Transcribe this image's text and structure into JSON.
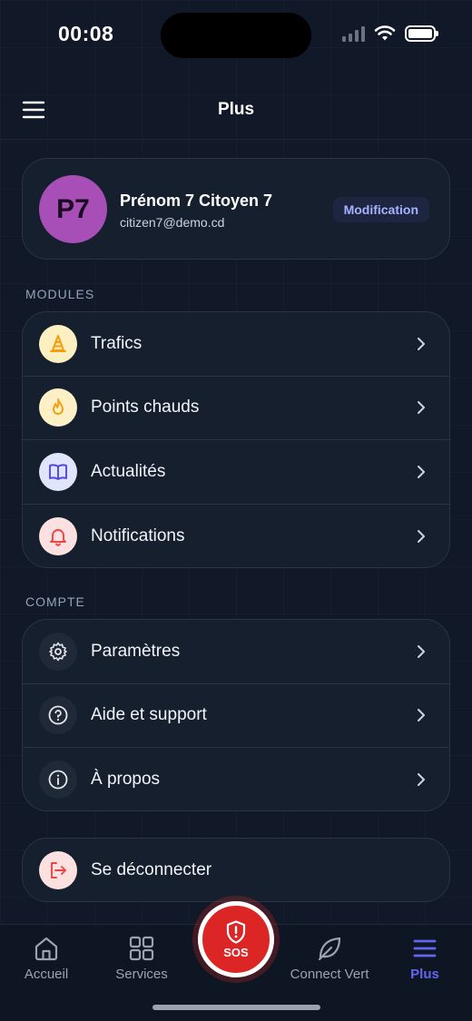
{
  "status_bar": {
    "time": "00:08"
  },
  "header": {
    "title": "Plus"
  },
  "profile": {
    "initials": "P7",
    "name": "Prénom 7 Citoyen 7",
    "email": "citizen7@demo.cd",
    "edit_label": "Modification",
    "avatar_color": "#a84fb7"
  },
  "modules": {
    "title": "MODULES",
    "items": [
      {
        "label": "Trafics",
        "icon": "traffic-cone-icon"
      },
      {
        "label": "Points chauds",
        "icon": "flame-icon"
      },
      {
        "label": "Actualités",
        "icon": "book-open-icon"
      },
      {
        "label": "Notifications",
        "icon": "bell-icon"
      }
    ]
  },
  "account": {
    "title": "COMPTE",
    "items": [
      {
        "label": "Paramètres",
        "icon": "gear-icon"
      },
      {
        "label": "Aide et support",
        "icon": "help-circle-icon"
      },
      {
        "label": "À propos",
        "icon": "info-icon"
      }
    ]
  },
  "logout": {
    "label": "Se déconnecter",
    "icon": "logout-icon"
  },
  "tabbar": {
    "items": [
      {
        "label": "Accueil",
        "icon": "home-icon"
      },
      {
        "label": "Services",
        "icon": "grid-icon"
      },
      {
        "label": "Connect Vert",
        "icon": "leaf-icon"
      },
      {
        "label": "Plus",
        "icon": "menu-icon",
        "active": true
      }
    ],
    "sos_label": "SOS"
  },
  "colors": {
    "accent": "#6366f1",
    "sos": "#dc2626",
    "background": "#111827"
  }
}
